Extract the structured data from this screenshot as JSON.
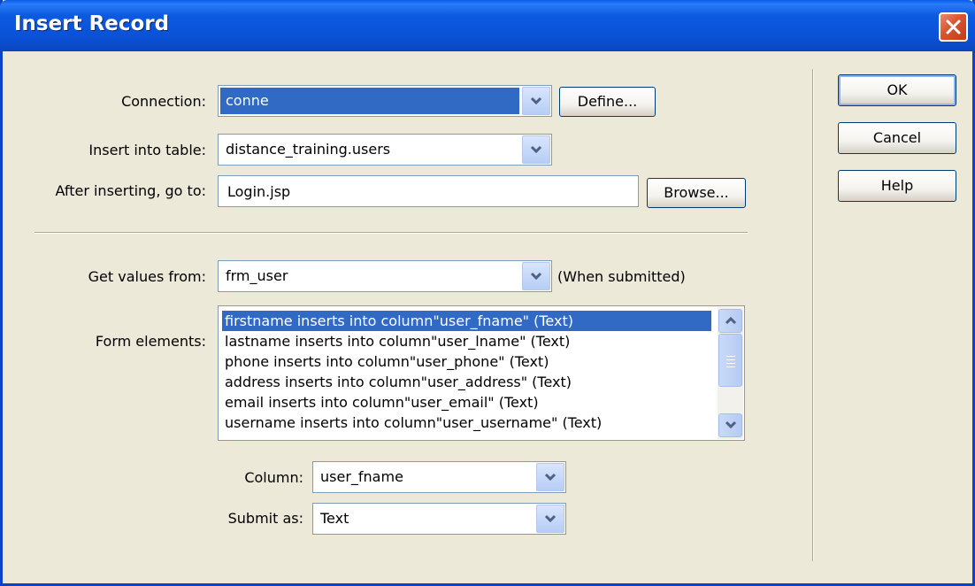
{
  "window": {
    "title": "Insert Record"
  },
  "connection": {
    "label": "Connection:",
    "value": "conne",
    "define_label": "Define..."
  },
  "insert_table": {
    "label": "Insert into table:",
    "value": "distance_training.users"
  },
  "after_insert": {
    "label": "After inserting, go to:",
    "value": "Login.jsp",
    "browse_label": "Browse..."
  },
  "get_values": {
    "label": "Get values from:",
    "value": "frm_user",
    "note": "(When submitted)"
  },
  "form_elements": {
    "label": "Form elements:",
    "items": [
      "firstname inserts into column\"user_fname\" (Text)",
      "lastname inserts into column\"user_lname\" (Text)",
      "phone inserts into column\"user_phone\" (Text)",
      "address inserts into column\"user_address\" (Text)",
      "email inserts into column\"user_email\" (Text)",
      "username inserts into column\"user_username\" (Text)"
    ],
    "selected_index": 0
  },
  "column": {
    "label": "Column:",
    "value": "user_fname"
  },
  "submit_as": {
    "label": "Submit as:",
    "value": "Text"
  },
  "buttons": {
    "ok": "OK",
    "cancel": "Cancel",
    "help": "Help"
  },
  "colors": {
    "selection": "#316AC5",
    "titlebar": "#0A52D8",
    "dialog_bg": "#ECE9D8"
  }
}
